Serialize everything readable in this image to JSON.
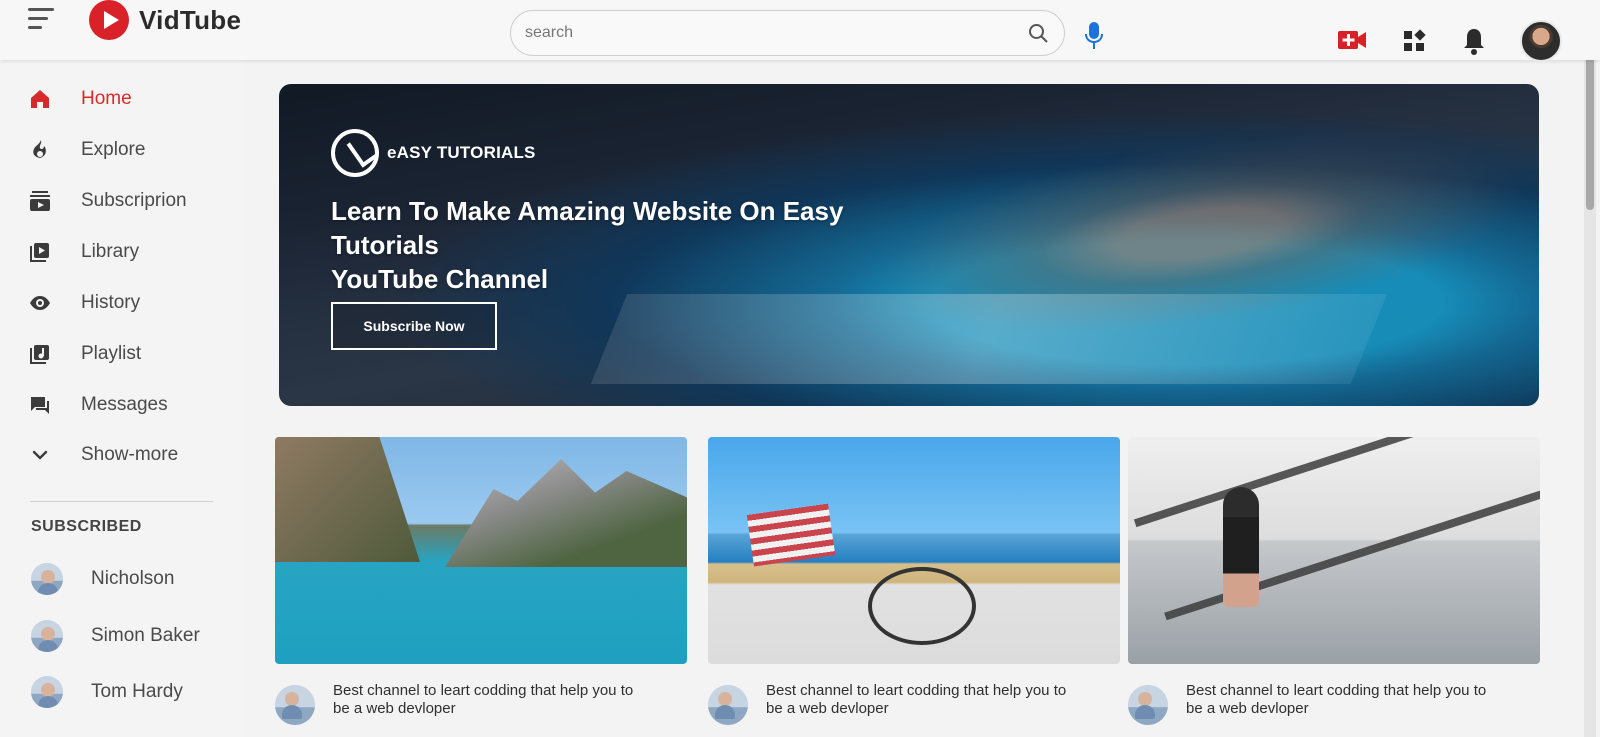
{
  "header": {
    "brand": "VidTube",
    "search": {
      "placeholder": "search",
      "value": ""
    },
    "accent": "#d9212a"
  },
  "sidebar": {
    "items": [
      {
        "label": "Home",
        "icon": "home-icon",
        "active": true
      },
      {
        "label": "Explore",
        "icon": "explore-icon"
      },
      {
        "label": "Subscriprion",
        "icon": "subscriptions-icon"
      },
      {
        "label": "Library",
        "icon": "library-icon"
      },
      {
        "label": "History",
        "icon": "history-icon"
      },
      {
        "label": "Playlist",
        "icon": "playlist-icon"
      },
      {
        "label": "Messages",
        "icon": "messages-icon"
      },
      {
        "label": "Show-more",
        "icon": "chevron-down-icon"
      }
    ],
    "subscribed_title": "SUBSCRIBED",
    "subscribed": [
      {
        "name": "Nicholson"
      },
      {
        "name": "Simon Baker"
      },
      {
        "name": "Tom Hardy"
      }
    ]
  },
  "banner": {
    "brand": "eASY TUTORIALS",
    "title_line_1": "Learn To Make Amazing Website On Easy Tutorials",
    "title_line_2": "YouTube Channel",
    "button": "Subscribe Now"
  },
  "videos": [
    {
      "title_line_1": "Best channel to leart codding that help you to",
      "title_line_2": "be a web devloper"
    },
    {
      "title_line_1": "Best channel to leart codding that help you to",
      "title_line_2": "be a web devloper"
    },
    {
      "title_line_1": "Best channel to leart codding that help you to",
      "title_line_2": "be a web devloper"
    }
  ]
}
